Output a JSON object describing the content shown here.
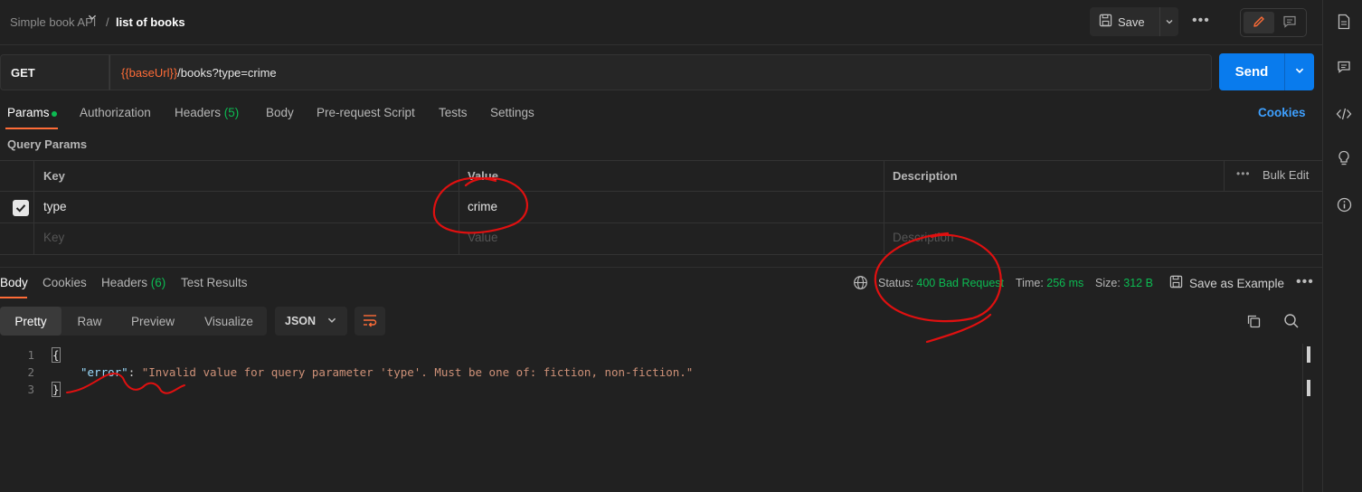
{
  "header": {
    "collection": "Simple book API",
    "separator": "/",
    "request_name": "list of books",
    "save_label": "Save"
  },
  "request": {
    "method": "GET",
    "url_variable": "{{baseUrl}}",
    "url_path": "/books?type=crime",
    "send_label": "Send"
  },
  "request_tabs": {
    "params": "Params",
    "authorization": "Authorization",
    "headers": "Headers",
    "headers_count": "(5)",
    "body": "Body",
    "pre_request": "Pre-request Script",
    "tests": "Tests",
    "settings": "Settings",
    "cookies": "Cookies"
  },
  "query_params": {
    "title": "Query Params",
    "columns": {
      "key": "Key",
      "value": "Value",
      "description": "Description",
      "bulk_edit": "Bulk Edit"
    },
    "rows": [
      {
        "checked": true,
        "key": "type",
        "value": "crime",
        "description": ""
      }
    ],
    "placeholders": {
      "key": "Key",
      "value": "Value",
      "description": "Description"
    }
  },
  "response": {
    "tabs": {
      "body": "Body",
      "cookies": "Cookies",
      "headers": "Headers",
      "headers_count": "(6)",
      "test_results": "Test Results"
    },
    "status_label": "Status:",
    "status_value": "400 Bad Request",
    "time_label": "Time:",
    "time_value": "256 ms",
    "size_label": "Size:",
    "size_value": "312 B",
    "save_example": "Save as Example",
    "view_modes": [
      "Pretty",
      "Raw",
      "Preview",
      "Visualize"
    ],
    "format": "JSON",
    "line_numbers": [
      "1",
      "2",
      "3"
    ],
    "body": {
      "open_brace": "{",
      "key": "\"error\"",
      "colon": ":",
      "value": "\"Invalid value for query parameter 'type'. Must be one of: fiction, non-fiction.\"",
      "close_brace": "}"
    }
  },
  "colors": {
    "accent_orange": "#ff6c37",
    "send_blue": "#097bed",
    "status_green": "#0cbb52",
    "annotation_red": "#e01010"
  },
  "icons": [
    "save-icon",
    "chevron-down-icon",
    "more-icon",
    "pencil-icon",
    "comment-icon",
    "document-icon",
    "code-icon",
    "lightbulb-icon",
    "info-icon",
    "globe-icon",
    "checkbox-icon",
    "wrap-lines-icon",
    "copy-icon",
    "search-icon"
  ]
}
